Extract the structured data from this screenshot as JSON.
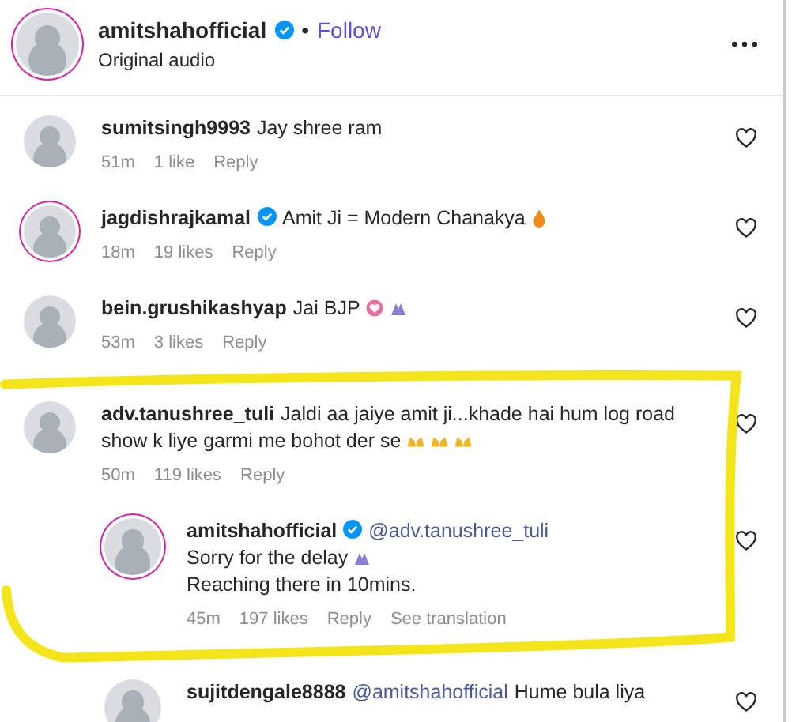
{
  "post_header": {
    "username": "amitshahofficial",
    "verified": true,
    "separator": "•",
    "follow": "Follow",
    "audio": "Original audio"
  },
  "comments": [
    {
      "kind": "comment",
      "username": "sumitsingh9993",
      "verified": false,
      "text": "Jay shree ram",
      "time": "51m",
      "likes": "1 like",
      "reply": "Reply"
    },
    {
      "kind": "comment",
      "username": "jagdishrajkamal",
      "verified": true,
      "text": "Amit Ji = Modern Chanakya",
      "icons": [
        {
          "kind": "fire"
        }
      ],
      "time": "18m",
      "likes": "19 likes",
      "reply": "Reply"
    },
    {
      "kind": "comment",
      "username": "bein.grushikashyap",
      "verified": false,
      "text": "Jai BJP",
      "icons": [
        {
          "kind": "heart"
        },
        {
          "kind": "hands"
        }
      ],
      "time": "53m",
      "likes": "3 likes",
      "reply": "Reply"
    },
    {
      "kind": "comment",
      "username": "adv.tanushree_tuli",
      "verified": false,
      "text": "Jaldi aa jaiye amit ji...khade hai hum log road show k liye garmi me bohot der se",
      "icons": [
        {
          "kind": "raised-hands"
        },
        {
          "kind": "raised-hands"
        },
        {
          "kind": "raised-hands"
        }
      ],
      "time": "50m",
      "likes": "119 likes",
      "reply": "Reply"
    },
    {
      "kind": "reply",
      "username": "amitshahofficial",
      "verified": true,
      "mention": "@adv.tanushree_tuli",
      "lines": [
        "Sorry for the delay",
        "Reaching there in 10mins."
      ],
      "icons": [
        {
          "kind": "hands"
        }
      ],
      "time": "45m",
      "likes": "197 likes",
      "reply": "Reply",
      "translate": "See translation"
    },
    {
      "kind": "reply",
      "username": "sujitdengale8888",
      "verified": false,
      "mention": "@amitshahofficial",
      "text": "Hume bula liya"
    }
  ]
}
